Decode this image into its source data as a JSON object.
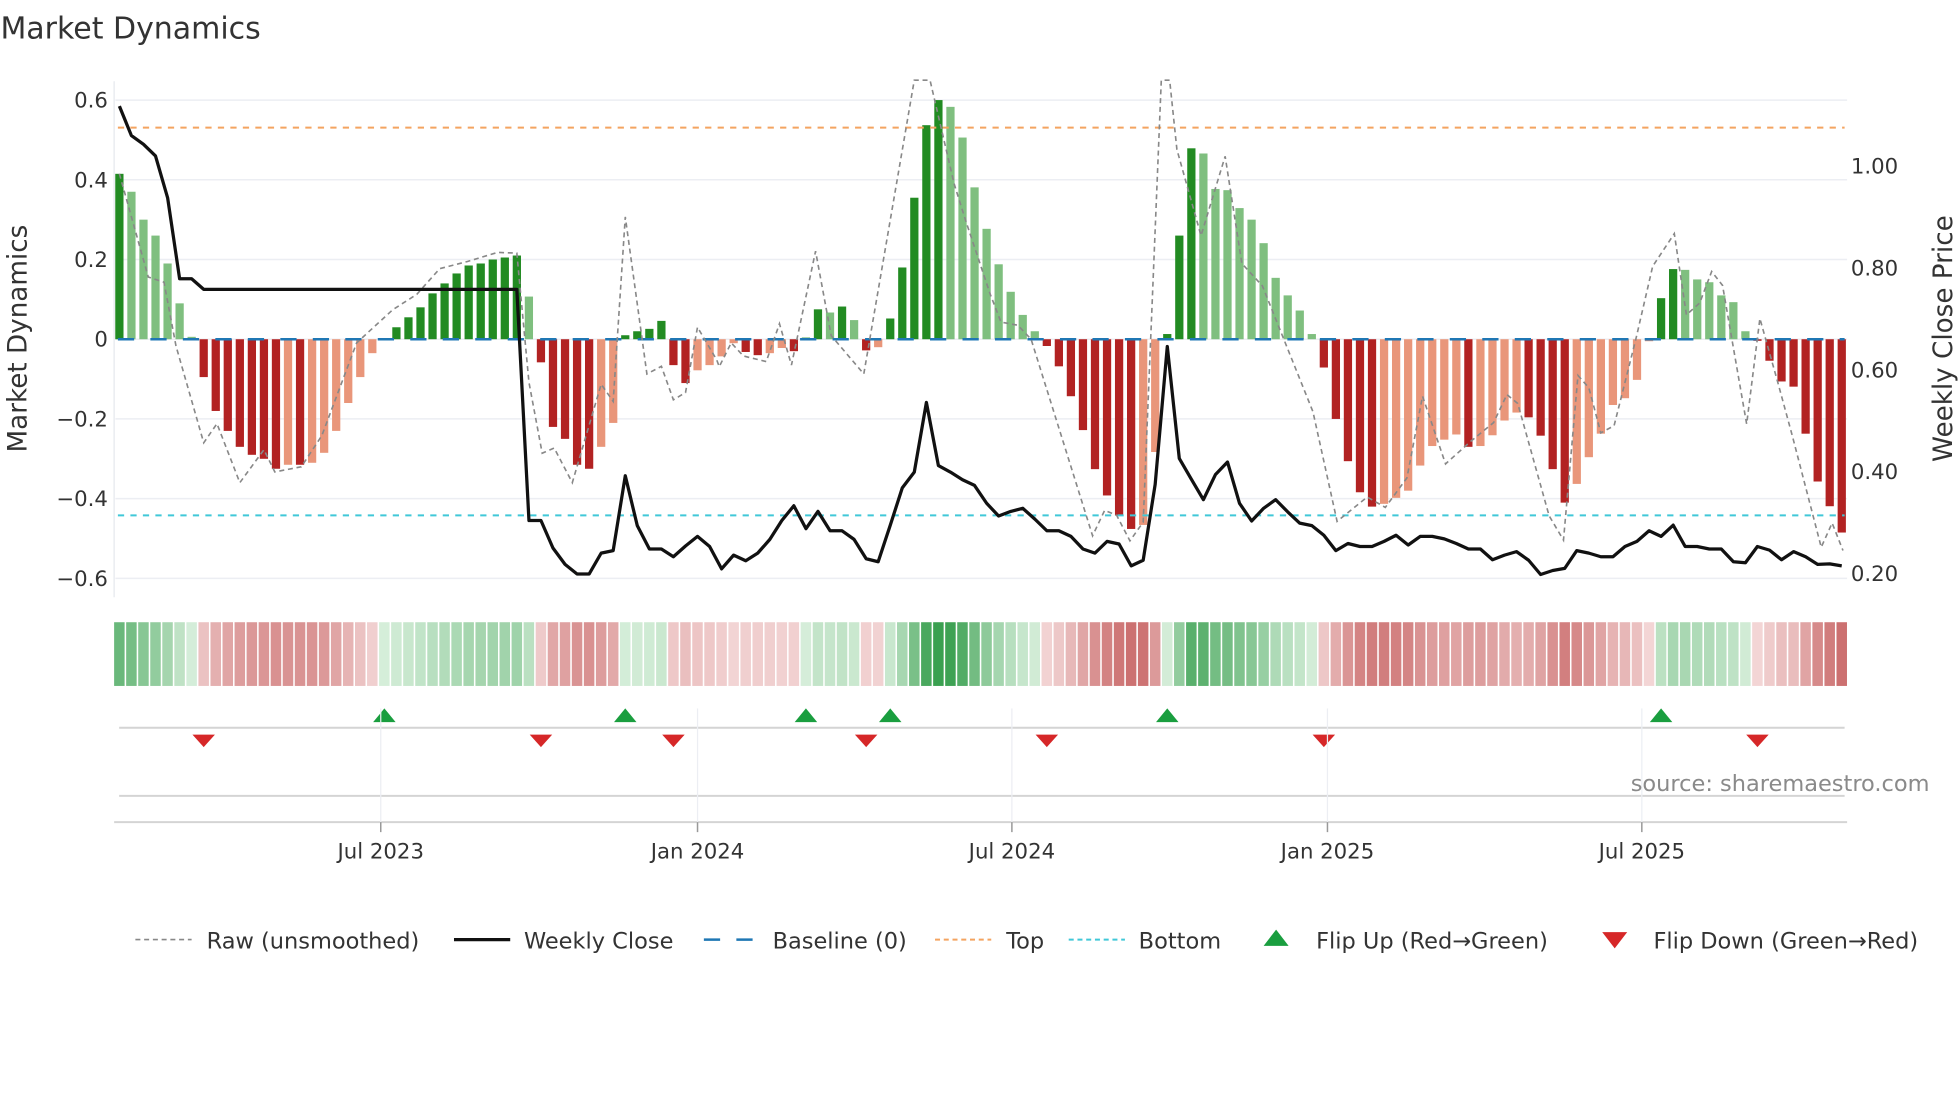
{
  "title": "Market Dynamics",
  "source": "source: sharemaestro.com",
  "colors": {
    "bar_up_strong": "#228b22",
    "bar_up_weak": "#7fbf7f",
    "bar_down_strong": "#b22222",
    "bar_down_weak": "#e9967a",
    "close": "#111111",
    "raw": "#888888",
    "baseline": "#1f77b4",
    "top": "#f4a460",
    "bottom": "#40c8d8",
    "flip_up": "#1a9e3f",
    "flip_down": "#d62728"
  },
  "legend": [
    {
      "key": "raw",
      "label": "Raw (unsmoothed)"
    },
    {
      "key": "close",
      "label": "Weekly Close"
    },
    {
      "key": "baseline",
      "label": "Baseline (0)"
    },
    {
      "key": "top",
      "label": "Top"
    },
    {
      "key": "bottom",
      "label": "Bottom"
    },
    {
      "key": "flip_up",
      "label": "Flip Up (Red→Green)"
    },
    {
      "key": "flip_down",
      "label": "Flip Down (Green→Red)"
    }
  ],
  "chart_data": {
    "type": "bar",
    "title": "Market Dynamics",
    "ylabel": "Market Dynamics",
    "y2label": "Weekly Close Price",
    "ylim": [
      -0.6,
      0.6
    ],
    "y2lim": [
      0.2,
      1.0
    ],
    "yticks": [
      "0.6",
      "0.4",
      "0.2",
      "0",
      "−0.2",
      "−0.4",
      "−0.6"
    ],
    "ytick_values": [
      0.6,
      0.4,
      0.2,
      0,
      -0.2,
      -0.4,
      -0.6
    ],
    "y2ticks": [
      "1.00",
      "0.80",
      "0.60",
      "0.40",
      "0.20"
    ],
    "y2tick_values": [
      1.0,
      0.8,
      0.6,
      0.4,
      0.2
    ],
    "x_unit": "week index",
    "xticks": [
      {
        "label": "Jul 2023",
        "week": 21.7
      },
      {
        "label": "Jan 2024",
        "week": 48.0
      },
      {
        "label": "Jul 2024",
        "week": 74.1
      },
      {
        "label": "Jan 2025",
        "week": 100.3
      },
      {
        "label": "Jul 2025",
        "week": 126.4
      }
    ],
    "top_level": 0.531,
    "bottom_level": -0.442,
    "baseline": 0,
    "smoothed": [
      0.415,
      0.37,
      0.3,
      0.26,
      0.19,
      0.09,
      0.006,
      -0.095,
      -0.18,
      -0.23,
      -0.27,
      -0.29,
      -0.3,
      -0.325,
      -0.315,
      -0.315,
      -0.31,
      -0.285,
      -0.23,
      -0.16,
      -0.095,
      -0.035,
      0.003,
      0.03,
      0.055,
      0.08,
      0.115,
      0.14,
      0.165,
      0.185,
      0.19,
      0.2,
      0.205,
      0.21,
      0.107,
      -0.058,
      -0.22,
      -0.25,
      -0.315,
      -0.325,
      -0.27,
      -0.21,
      0.01,
      0.02,
      0.026,
      0.046,
      -0.065,
      -0.11,
      -0.078,
      -0.065,
      -0.043,
      -0.01,
      -0.032,
      -0.04,
      -0.035,
      -0.022,
      -0.03,
      0.004,
      0.075,
      0.067,
      0.082,
      0.048,
      -0.028,
      -0.02,
      0.052,
      0.18,
      0.355,
      0.537,
      0.6,
      0.583,
      0.506,
      0.381,
      0.277,
      0.188,
      0.119,
      0.061,
      0.02,
      -0.017,
      -0.068,
      -0.143,
      -0.228,
      -0.326,
      -0.392,
      -0.442,
      -0.476,
      -0.466,
      -0.283,
      0.013,
      0.26,
      0.479,
      0.466,
      0.377,
      0.374,
      0.329,
      0.3,
      0.241,
      0.154,
      0.11,
      0.072,
      0.013,
      -0.071,
      -0.2,
      -0.306,
      -0.384,
      -0.42,
      -0.413,
      -0.398,
      -0.38,
      -0.317,
      -0.268,
      -0.252,
      -0.239,
      -0.27,
      -0.268,
      -0.241,
      -0.204,
      -0.184,
      -0.196,
      -0.242,
      -0.326,
      -0.41,
      -0.363,
      -0.296,
      -0.237,
      -0.165,
      -0.148,
      -0.102,
      -0.005,
      0.103,
      0.176,
      0.174,
      0.15,
      0.143,
      0.11,
      0.093,
      0.02,
      -0.004,
      -0.054,
      -0.106,
      -0.119,
      -0.237,
      -0.357,
      -0.419,
      -0.485
    ],
    "weekly_close": [
      1.118,
      1.06,
      1.043,
      1.02,
      0.938,
      0.779,
      0.779,
      0.758,
      0.758,
      0.758,
      0.758,
      0.758,
      0.758,
      0.758,
      0.758,
      0.758,
      0.758,
      0.758,
      0.758,
      0.758,
      0.758,
      0.758,
      0.758,
      0.758,
      0.758,
      0.758,
      0.758,
      0.758,
      0.758,
      0.758,
      0.758,
      0.758,
      0.758,
      0.758,
      0.304,
      0.304,
      0.25,
      0.218,
      0.199,
      0.199,
      0.24,
      0.245,
      0.392,
      0.294,
      0.248,
      0.248,
      0.233,
      0.254,
      0.273,
      0.253,
      0.209,
      0.236,
      0.225,
      0.24,
      0.267,
      0.304,
      0.333,
      0.288,
      0.322,
      0.284,
      0.284,
      0.267,
      0.229,
      0.223,
      0.295,
      0.368,
      0.399,
      0.536,
      0.412,
      0.399,
      0.384,
      0.373,
      0.338,
      0.313,
      0.322,
      0.328,
      0.307,
      0.284,
      0.284,
      0.273,
      0.248,
      0.24,
      0.263,
      0.258,
      0.215,
      0.226,
      0.375,
      0.646,
      0.426,
      0.385,
      0.345,
      0.394,
      0.419,
      0.338,
      0.303,
      0.328,
      0.345,
      0.321,
      0.299,
      0.294,
      0.275,
      0.245,
      0.259,
      0.253,
      0.253,
      0.263,
      0.275,
      0.256,
      0.273,
      0.273,
      0.268,
      0.259,
      0.248,
      0.248,
      0.227,
      0.236,
      0.243,
      0.226,
      0.198,
      0.206,
      0.21,
      0.245,
      0.24,
      0.233,
      0.233,
      0.253,
      0.263,
      0.284,
      0.273,
      0.295,
      0.253,
      0.253,
      0.248,
      0.248,
      0.223,
      0.221,
      0.253,
      0.246,
      0.227,
      0.243,
      0.233,
      0.218,
      0.219,
      0.215
    ],
    "raw_points": [
      [
        1,
        0.415
      ],
      [
        3.4,
        0.156
      ],
      [
        4.7,
        0.143
      ],
      [
        5.7,
        -0.017
      ],
      [
        8,
        -0.26
      ],
      [
        9.1,
        -0.212
      ],
      [
        11,
        -0.36
      ],
      [
        13,
        -0.277
      ],
      [
        13.9,
        -0.333
      ],
      [
        16.1,
        -0.32
      ],
      [
        17.8,
        -0.242
      ],
      [
        20.7,
        -0.009
      ],
      [
        23.7,
        0.074
      ],
      [
        25.7,
        0.113
      ],
      [
        27.6,
        0.177
      ],
      [
        29.9,
        0.195
      ],
      [
        32.4,
        0.218
      ],
      [
        34,
        0.216
      ],
      [
        35,
        -0.108
      ],
      [
        36.1,
        -0.286
      ],
      [
        37.1,
        -0.273
      ],
      [
        38.6,
        -0.36
      ],
      [
        41,
        -0.113
      ],
      [
        42,
        -0.156
      ],
      [
        43,
        0.307
      ],
      [
        44.8,
        -0.087
      ],
      [
        46,
        -0.068
      ],
      [
        47,
        -0.152
      ],
      [
        48,
        -0.134
      ],
      [
        49,
        0.03
      ],
      [
        50.6,
        -0.052
      ],
      [
        50.8,
        -0.069
      ],
      [
        51.8,
        -0.009
      ],
      [
        52.8,
        -0.042
      ],
      [
        54.7,
        -0.056
      ],
      [
        55.8,
        0.039
      ],
      [
        56.8,
        -0.065
      ],
      [
        58.8,
        0.221
      ],
      [
        60.1,
        0.009
      ],
      [
        62.8,
        -0.087
      ],
      [
        67,
        0.65
      ],
      [
        68.3,
        0.65
      ],
      [
        70.3,
        0.39
      ],
      [
        71.3,
        0.294
      ],
      [
        73.3,
        0.113
      ],
      [
        74.2,
        0.043
      ],
      [
        75.6,
        0.035
      ],
      [
        76.7,
        0
      ],
      [
        81.8,
        -0.493
      ],
      [
        82.8,
        -0.429
      ],
      [
        83.8,
        -0.442
      ],
      [
        84.9,
        -0.506
      ],
      [
        86,
        -0.459
      ],
      [
        87.5,
        0.65
      ],
      [
        88.2,
        0.65
      ],
      [
        88.8,
        0.476
      ],
      [
        90.8,
        0.26
      ],
      [
        92.8,
        0.459
      ],
      [
        94.2,
        0.19
      ],
      [
        95.9,
        0.134
      ],
      [
        100.1,
        -0.182
      ],
      [
        102.1,
        -0.457
      ],
      [
        104.6,
        -0.396
      ],
      [
        106.1,
        -0.422
      ],
      [
        107.9,
        -0.348
      ],
      [
        109.2,
        -0.143
      ],
      [
        111.1,
        -0.313
      ],
      [
        113.2,
        -0.256
      ],
      [
        115.1,
        -0.209
      ],
      [
        116.2,
        -0.139
      ],
      [
        117.1,
        -0.161
      ],
      [
        119.7,
        -0.443
      ],
      [
        120.9,
        -0.504
      ],
      [
        122.1,
        -0.091
      ],
      [
        123,
        -0.122
      ],
      [
        124,
        -0.235
      ],
      [
        125.1,
        -0.217
      ],
      [
        126.9,
        0
      ],
      [
        128.3,
        0.183
      ],
      [
        130.1,
        0.265
      ],
      [
        131.1,
        0.061
      ],
      [
        132.2,
        0.091
      ],
      [
        133.2,
        0.17
      ],
      [
        134.1,
        0.135
      ],
      [
        136.1,
        -0.213
      ],
      [
        137.2,
        0.052
      ],
      [
        138.7,
        -0.109
      ],
      [
        139.9,
        -0.243
      ],
      [
        142.3,
        -0.522
      ],
      [
        143.2,
        -0.461
      ],
      [
        144.1,
        -0.53
      ]
    ],
    "flip_up_weeks": [
      23,
      43,
      58,
      65,
      88,
      129
    ],
    "flip_down_weeks": [
      8,
      36,
      47,
      63,
      78,
      101,
      137
    ],
    "legend_position": "bottom"
  }
}
